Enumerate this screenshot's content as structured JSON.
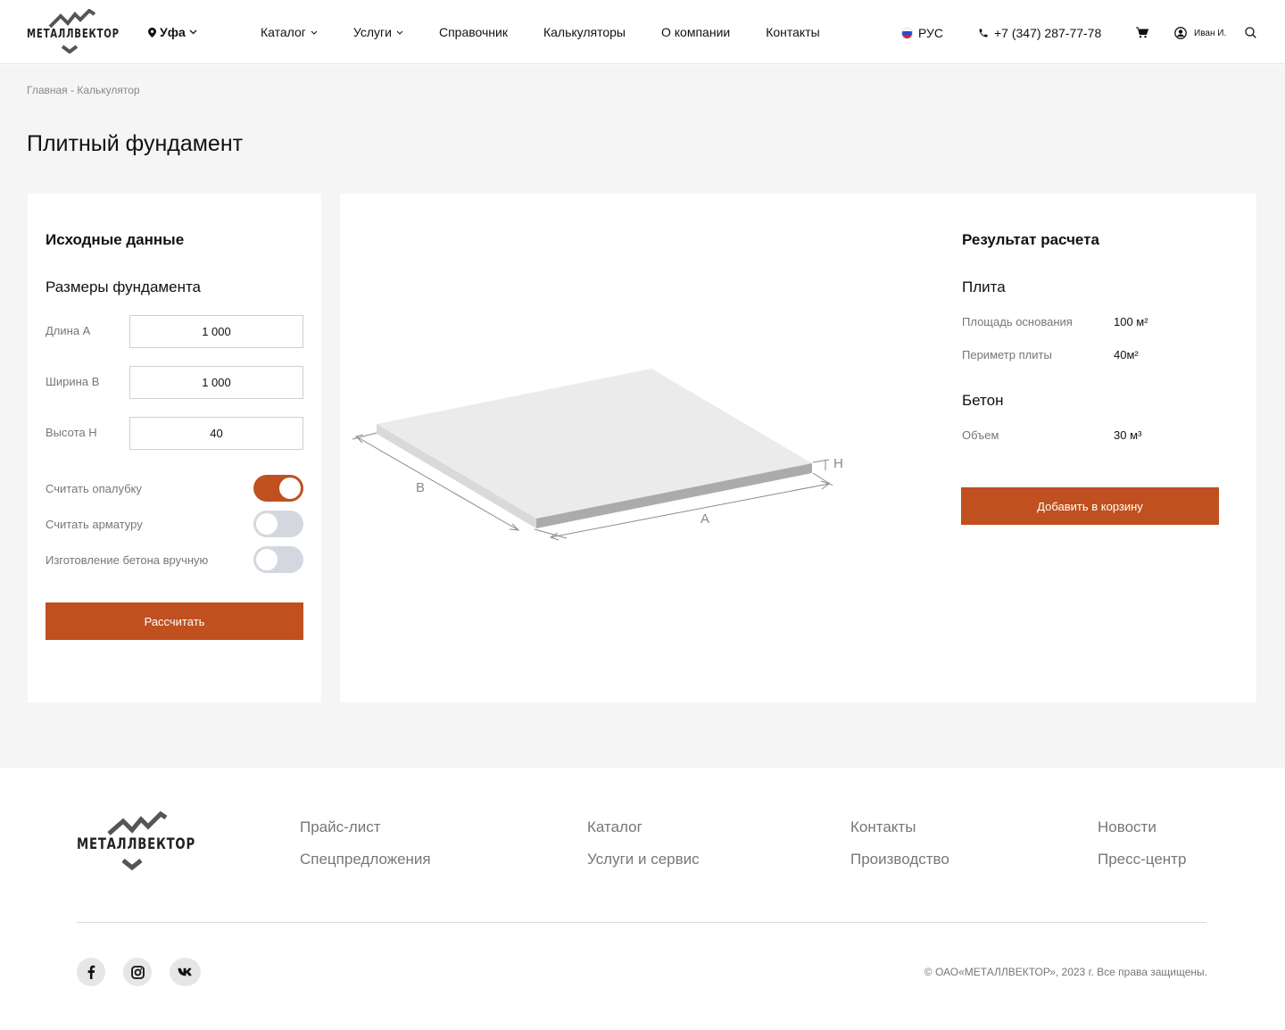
{
  "header": {
    "logo_text": "МЕТАЛЛВЕКТОР",
    "city": "Уфа",
    "nav": [
      {
        "label": "Каталог",
        "has_dropdown": true
      },
      {
        "label": "Услуги",
        "has_dropdown": true
      },
      {
        "label": "Справочник",
        "has_dropdown": false
      },
      {
        "label": "Калькуляторы",
        "has_dropdown": false
      },
      {
        "label": "О компании",
        "has_dropdown": false
      },
      {
        "label": "Контакты",
        "has_dropdown": false
      }
    ],
    "language": "РУС",
    "phone": "+7 (347) 287-77-78",
    "user_name": "Иван И.",
    "icons": [
      "location-pin-icon",
      "chevron-down-icon",
      "flag-ru-icon",
      "phone-icon",
      "cart-icon",
      "user-icon",
      "search-icon"
    ]
  },
  "breadcrumb": "Главная - Калькулятор",
  "page_title": "Плитный фундамент",
  "input_panel": {
    "title": "Исходные данные",
    "section_title": "Размеры фундамента",
    "fields": [
      {
        "label": "Длина А",
        "value": "1 000"
      },
      {
        "label": "Ширина В",
        "value": "1 000"
      },
      {
        "label": "Высота Н",
        "value": "40"
      }
    ],
    "toggles": [
      {
        "label": "Считать опалубку",
        "on": true
      },
      {
        "label": "Считать арматуру",
        "on": false
      },
      {
        "label": "Изготовление бетона вручную",
        "on": false
      }
    ],
    "calculate_label": "Рассчитать"
  },
  "diagram": {
    "label_a": "A",
    "label_b": "B",
    "label_h": "H"
  },
  "result_panel": {
    "title": "Результат расчета",
    "sections": [
      {
        "title": "Плита",
        "rows": [
          {
            "label": "Площадь основания",
            "value": "100 м²"
          },
          {
            "label": "Периметр плиты",
            "value": "40м²"
          }
        ]
      },
      {
        "title": "Бетон",
        "rows": [
          {
            "label": "Объем",
            "value": "30 м³"
          }
        ]
      }
    ],
    "add_to_cart_label": "Добавить в корзину"
  },
  "footer": {
    "logo_text": "МЕТАЛЛВЕКТОР",
    "links": [
      [
        "Прайс-лист",
        "Спецпредложения"
      ],
      [
        "Каталог",
        "Услуги и сервис"
      ],
      [
        "Контакты",
        "Производство"
      ],
      [
        "Новости",
        "Пресс-центр"
      ]
    ],
    "social": [
      "facebook-icon",
      "instagram-icon",
      "vk-icon"
    ],
    "copyright": "© ОАО«МЕТАЛЛВЕКТОР», 2023 г. Все права защищены."
  },
  "colors": {
    "accent": "#c0501f",
    "background": "#f5f5f5",
    "toggle_off": "#d4d8de",
    "muted_text": "#777777"
  }
}
